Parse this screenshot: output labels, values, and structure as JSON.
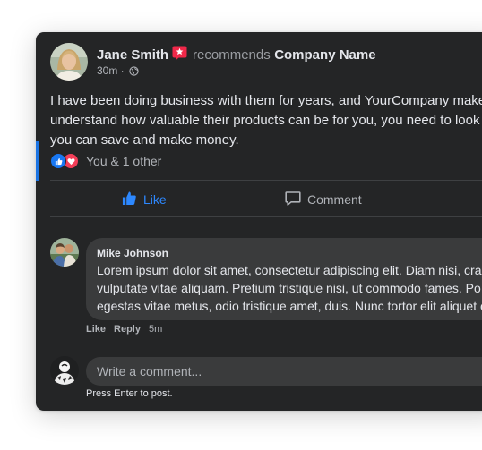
{
  "post": {
    "author_name": "Jane Smith",
    "recommend_text": "recommends",
    "company_name": "Company Name",
    "time": "30m ·",
    "body_lines": [
      "I have been doing business with them for years, and YourCompany makes it s",
      "understand how valuable their products can be for you, you need to look at wh",
      "you can save and make money."
    ],
    "reactions_text": "You & 1 other"
  },
  "actions": {
    "like_label": "Like",
    "comment_label": "Comment"
  },
  "comment": {
    "author_name": "Mike Johnson",
    "lines": [
      "Lorem ipsum dolor sit amet, consectetur adipiscing elit. Diam nisi, cra",
      "vulputate vitae aliquam. Pretium tristique nisi, ut commodo fames. Po",
      "egestas vitae metus, odio tristique amet, duis. Nunc tortor elit aliquet e"
    ],
    "like_label": "Like",
    "reply_label": "Reply",
    "time": "5m"
  },
  "composer": {
    "placeholder": "Write a comment...",
    "hint": "Press Enter to post."
  },
  "colors": {
    "card_background": "#242526",
    "accent": "#1b74e4",
    "like_blue": "#2d88ff",
    "love_red": "#f33e58",
    "recommend_badge": "#f02849"
  }
}
